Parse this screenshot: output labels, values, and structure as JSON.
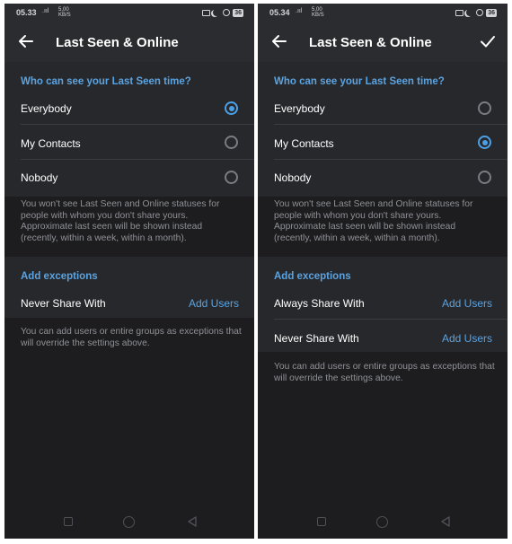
{
  "left": {
    "status": {
      "time": "05.33",
      "signal": ".ııl",
      "network": "4G",
      "network_top": "5,00",
      "network_bottom": "KB/S",
      "battery": "36"
    },
    "title": "Last Seen & Online",
    "section_header": "Who can see your Last Seen time?",
    "options": [
      {
        "label": "Everybody",
        "selected": true
      },
      {
        "label": "My Contacts",
        "selected": false
      },
      {
        "label": "Nobody",
        "selected": false
      }
    ],
    "info": "You won't see Last Seen and Online statuses for people with whom you don't share yours. Approximate last seen will be shown instead (recently, within a week, within a month).",
    "exceptions_header": "Add exceptions",
    "exceptions": [
      {
        "label": "Never Share With",
        "action": "Add Users"
      }
    ],
    "exceptions_info": "You can add users or entire groups as exceptions that will override the settings above."
  },
  "right": {
    "status": {
      "time": "05.34",
      "signal": ".ııl",
      "network": "4G",
      "network_top": "5,00",
      "network_bottom": "KB/S",
      "battery": "36"
    },
    "title": "Last Seen & Online",
    "section_header": "Who can see your Last Seen time?",
    "options": [
      {
        "label": "Everybody",
        "selected": false
      },
      {
        "label": "My Contacts",
        "selected": true
      },
      {
        "label": "Nobody",
        "selected": false
      }
    ],
    "info": "You won't see Last Seen and Online statuses for people with whom you don't share yours. Approximate last seen will be shown instead (recently, within a week, within a month).",
    "exceptions_header": "Add exceptions",
    "exceptions": [
      {
        "label": "Always Share With",
        "action": "Add Users"
      },
      {
        "label": "Never Share With",
        "action": "Add Users"
      }
    ],
    "exceptions_info": "You can add users or entire groups as exceptions that will override the settings above."
  },
  "colors": {
    "accent": "#5ba3e0",
    "background": "#1d1d20",
    "panel": "#27282c",
    "text_secondary": "#8f9196"
  },
  "icons": [
    "back-arrow-icon",
    "checkmark-icon",
    "radio-selected-icon",
    "radio-unselected-icon",
    "nav-square-icon",
    "nav-circle-icon",
    "nav-back-icon",
    "cast-icon",
    "moon-icon",
    "alarm-icon",
    "battery-icon"
  ]
}
